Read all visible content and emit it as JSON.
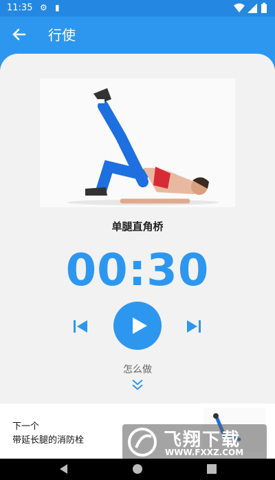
{
  "status": {
    "time": "11:35",
    "icons": [
      "gear-icon",
      "sd-card-icon",
      "wifi-icon",
      "signal-icon",
      "battery-icon"
    ]
  },
  "app_bar": {
    "title": "行使"
  },
  "exercise": {
    "name": "单腿直角桥",
    "timer": "00:30",
    "how_to": "怎么做"
  },
  "next_up": {
    "label": "下一个",
    "name": "带延长腿的消防栓"
  },
  "watermark": {
    "text": "飞翔下载",
    "url": "WWW.FXXZ.COM"
  },
  "colors": {
    "primary": "#2d97f0",
    "status_bar": "#2488e2",
    "card_bg": "#f2f2f2"
  }
}
